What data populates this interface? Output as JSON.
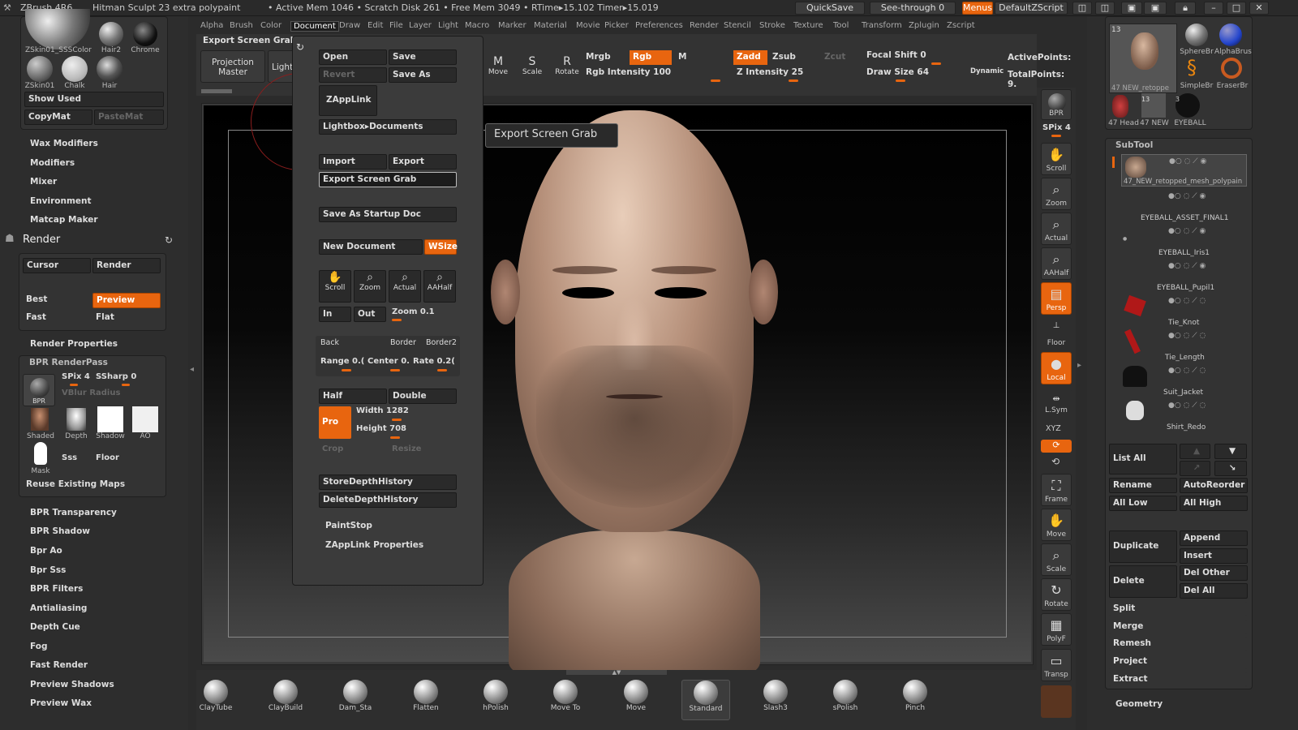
{
  "titlebar": {
    "app": "ZBrush 4R6",
    "doc": "Hitman Sculpt 23 extra polypaint",
    "mem": "• Active Mem 1046 • Scratch Disk 261 • Free Mem 3049 • RTime▸15.102 Timer▸15.019",
    "quicksave": "QuickSave",
    "seethrough": "See-through 0",
    "menus": "Menus",
    "script": "DefaultZScript"
  },
  "menubar": [
    "Alpha",
    "Brush",
    "Color",
    "Document",
    "Draw",
    "Edit",
    "File",
    "Layer",
    "Light",
    "Macro",
    "Marker",
    "Material",
    "Movie",
    "Picker",
    "Preferences",
    "Render",
    "Stencil",
    "Stroke",
    "Texture",
    "Tool",
    "Transform",
    "Zplugin",
    "Zscript"
  ],
  "materials": {
    "items": [
      "ZSkin01_SSSColor",
      "Hair2",
      "Chrome",
      "ZSkin01",
      "Chalk",
      "Hair"
    ],
    "show_used": "Show Used",
    "copymat": "CopyMat",
    "pastemat": "PasteMat"
  },
  "left_items_top": [
    "Wax Modifiers",
    "Modifiers",
    "Mixer",
    "Environment",
    "Matcap Maker"
  ],
  "render": {
    "title": "Render",
    "cursor": "Cursor",
    "render_btn": "Render",
    "best": "Best",
    "preview": "Preview",
    "fast": "Fast",
    "flat": "Flat",
    "props": "Render Properties",
    "bpr_renderpass": "BPR RenderPass",
    "spix": "SPix 4",
    "ssharp": "SSharp 0",
    "vblur": "VBlur Radius",
    "passes": [
      "Shaded",
      "Depth",
      "Shadow",
      "AO",
      "Mask",
      "Sss",
      "Floor"
    ],
    "bpr_label": "BPR",
    "reuse": "Reuse Existing Maps"
  },
  "left_items_bottom": [
    "BPR Transparency",
    "BPR Shadow",
    "Bpr Ao",
    "Bpr Sss",
    "BPR Filters",
    "Antialiasing",
    "Depth Cue",
    "Fog",
    "Fast Render",
    "Preview Shadows",
    "Preview Wax"
  ],
  "top_toolbar": {
    "export_title": "Export Screen Grab",
    "projection": "Projection Master",
    "lightbox": "LightBox",
    "move": "Move",
    "scale": "Scale",
    "rotate": "Rotate",
    "mrgb": "Mrgb",
    "rgb": "Rgb",
    "m": "M",
    "rgb_intensity": "Rgb Intensity 100",
    "zadd": "Zadd",
    "zsub": "Zsub",
    "zcut": "Zcut",
    "z_intensity": "Z Intensity 25",
    "focal": "Focal Shift 0",
    "draw_size": "Draw Size 64",
    "dynamic": "Dynamic",
    "active_points": "ActivePoints:",
    "total_points": "TotalPoints: 9."
  },
  "document_menu": {
    "open": "Open",
    "save": "Save",
    "revert": "Revert",
    "save_as": "Save As",
    "zapplink": "ZAppLink",
    "lightbox_docs": "Lightbox▸Documents",
    "import": "Import",
    "export": "Export",
    "export_grab": "Export Screen Grab",
    "save_startup": "Save As Startup Doc",
    "new_doc": "New Document",
    "wsize": "WSize",
    "scroll": "Scroll",
    "zoom": "Zoom",
    "actual": "Actual",
    "aahalf": "AAHalf",
    "in": "In",
    "out": "Out",
    "zoom_val": "Zoom 0.1",
    "back": "Back",
    "border": "Border",
    "border2": "Border2",
    "range": "Range 0.(",
    "center": "Center 0.",
    "rate": "Rate 0.2(",
    "half": "Half",
    "double": "Double",
    "pro": "Pro",
    "width": "Width 1282",
    "height": "Height 708",
    "crop": "Crop",
    "resize": "Resize",
    "store_depth": "StoreDepthHistory",
    "delete_depth": "DeleteDepthHistory",
    "paintstop": "PaintStop",
    "zapplink_props": "ZAppLink Properties"
  },
  "tooltip": "Export Screen Grab",
  "right_tools": [
    {
      "name": "bpr",
      "label": "BPR"
    },
    {
      "name": "spix",
      "label": "SPix 4"
    },
    {
      "name": "scroll",
      "label": "Scroll"
    },
    {
      "name": "zoom",
      "label": "Zoom"
    },
    {
      "name": "actual",
      "label": "Actual"
    },
    {
      "name": "aahalf",
      "label": "AAHalf"
    },
    {
      "name": "persp",
      "label": "Persp"
    },
    {
      "name": "floor",
      "label": "Floor"
    },
    {
      "name": "local",
      "label": "Local"
    },
    {
      "name": "lsym",
      "label": "L.Sym"
    },
    {
      "name": "xyz",
      "label": "XYZ"
    },
    {
      "name": "frame",
      "label": "Frame"
    },
    {
      "name": "move",
      "label": "Move"
    },
    {
      "name": "scale",
      "label": "Scale"
    },
    {
      "name": "rotate",
      "label": "Rotate"
    },
    {
      "name": "polyf",
      "label": "PolyF"
    },
    {
      "name": "transp",
      "label": "Transp"
    }
  ],
  "tool_thumbs": {
    "count": "13",
    "labels": [
      "47 NEW_retoppe",
      "SphereBr",
      "AlphaBrus",
      "SimpleBr",
      "EraserBr",
      "47 Head",
      "47 NEW",
      "EYEBALL"
    ],
    "nums": [
      "13",
      "3"
    ]
  },
  "subtool": {
    "title": "SubTool",
    "rows": [
      "47_NEW_retopped_mesh_polypain",
      "EYEBALL_ASSET_FINAL1",
      "EYEBALL_Iris1",
      "EYEBALL_Pupil1",
      "Tie_Knot",
      "Tie_Length",
      "Suit_Jacket",
      "Shirt_Redo"
    ],
    "list_all": "List All",
    "rename": "Rename",
    "autoreorder": "AutoReorder",
    "all_low": "All Low",
    "all_high": "All High",
    "duplicate": "Duplicate",
    "append": "Append",
    "insert": "Insert",
    "delete": "Delete",
    "del_other": "Del Other",
    "del_all": "Del All",
    "split": "Split",
    "merge": "Merge",
    "remesh": "Remesh",
    "project": "Project",
    "extract": "Extract",
    "geometry": "Geometry"
  },
  "brushes": [
    "ClayTube",
    "ClayBuild",
    "Dam_Sta",
    "Flatten",
    "hPolish",
    "Move To",
    "Move",
    "Standard",
    "Slash3",
    "sPolish",
    "Pinch"
  ]
}
